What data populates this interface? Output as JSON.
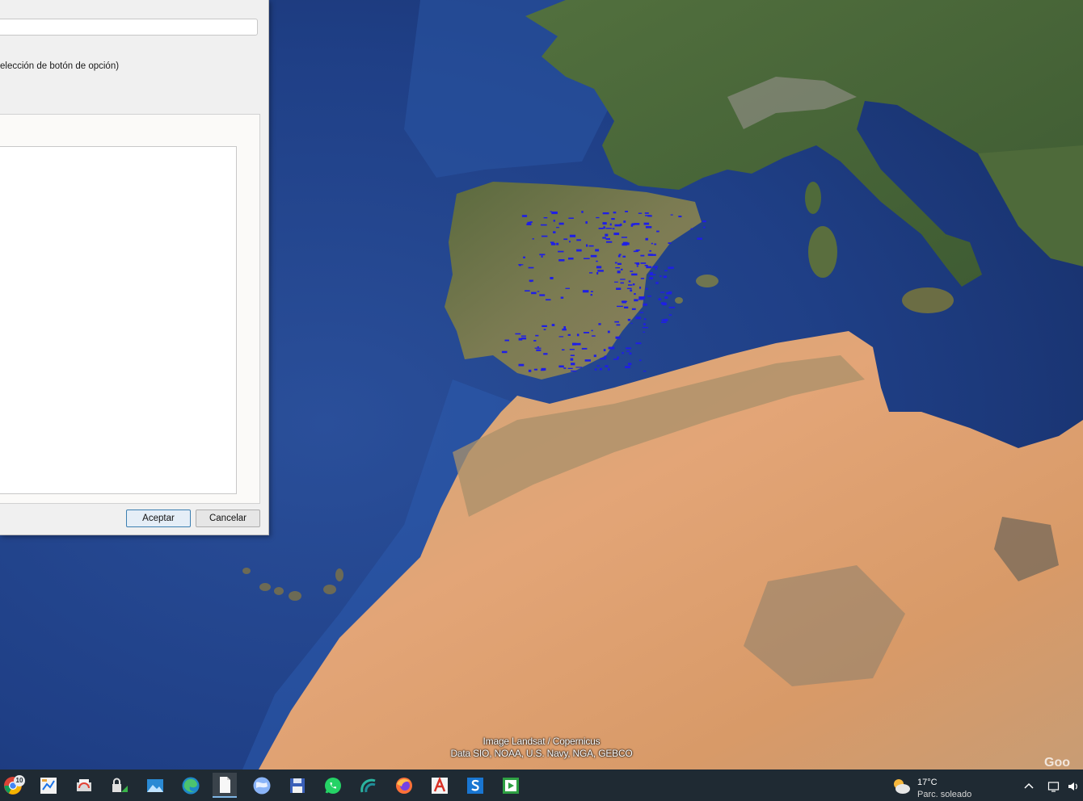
{
  "dialog": {
    "name_field_value": "",
    "radio_hint": "elección de botón de opción)",
    "ok_label": "Aceptar",
    "cancel_label": "Cancelar"
  },
  "map": {
    "attribution_line1": "Image Landsat / Copernicus",
    "attribution_line2": "Data SIO, NOAA, U.S. Navy, NGA, GEBCO",
    "watermark": "Goo",
    "marker_color": "#1e1ee6",
    "ocean_color": "#1f3f86",
    "land_green": "#4a6638",
    "desert_color": "#d9a06e"
  },
  "taskbar": {
    "items": [
      {
        "icon": "chrome-icon",
        "badge": "10"
      },
      {
        "icon": "app-grid-icon"
      },
      {
        "icon": "printer-folder-icon"
      },
      {
        "icon": "network-lock-icon"
      },
      {
        "icon": "photos-icon"
      },
      {
        "icon": "edge-icon"
      },
      {
        "icon": "document-icon",
        "active": true
      },
      {
        "icon": "google-earth-icon"
      },
      {
        "icon": "save-disk-icon"
      },
      {
        "icon": "whatsapp-icon"
      },
      {
        "icon": "wave-app-icon"
      },
      {
        "icon": "firefox-icon"
      },
      {
        "icon": "acrobat-icon"
      },
      {
        "icon": "s-app-icon"
      },
      {
        "icon": "media-player-icon"
      }
    ],
    "weather": {
      "temp": "17°C",
      "desc": "Parc. soleado"
    },
    "tray": [
      "chevron-up-icon",
      "display-icon",
      "speaker-icon"
    ]
  }
}
